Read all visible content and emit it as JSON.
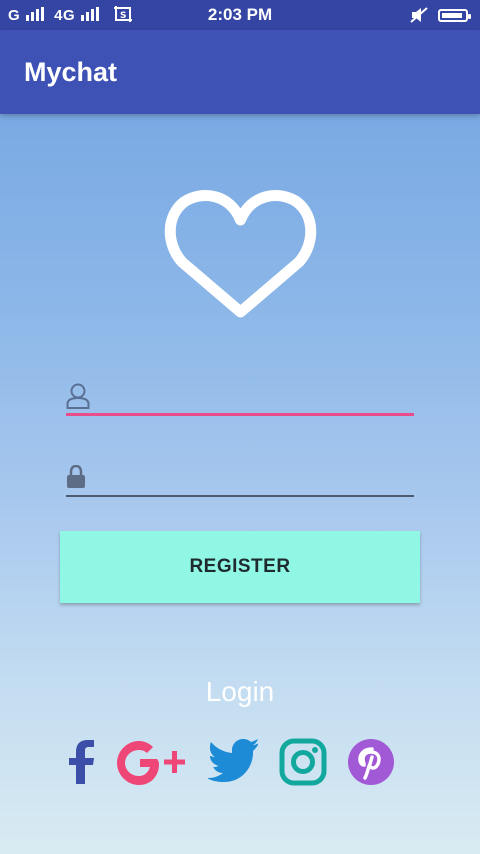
{
  "status_bar": {
    "carrier_1": "G",
    "carrier_2": "4G",
    "time": "2:03 PM",
    "battery_level": 0.9
  },
  "app_bar": {
    "title": "Mychat"
  },
  "form": {
    "username": {
      "value": "",
      "placeholder": "",
      "icon": "user-icon"
    },
    "password": {
      "value": "",
      "placeholder": "",
      "icon": "lock-icon"
    },
    "register_label": "REGISTER"
  },
  "login_label": "Login",
  "social": [
    {
      "name": "facebook",
      "color": "#3b4ea8"
    },
    {
      "name": "google-plus",
      "color": "#ef4678"
    },
    {
      "name": "twitter",
      "color": "#1d8bd6"
    },
    {
      "name": "instagram",
      "color": "#13a89e"
    },
    {
      "name": "pinterest",
      "color": "#a259d6"
    }
  ],
  "colors": {
    "status_bar": "#3545a4",
    "app_bar": "#3e52b5",
    "accent_underline": "#e84f8a",
    "register_button": "#8ff7e4"
  }
}
